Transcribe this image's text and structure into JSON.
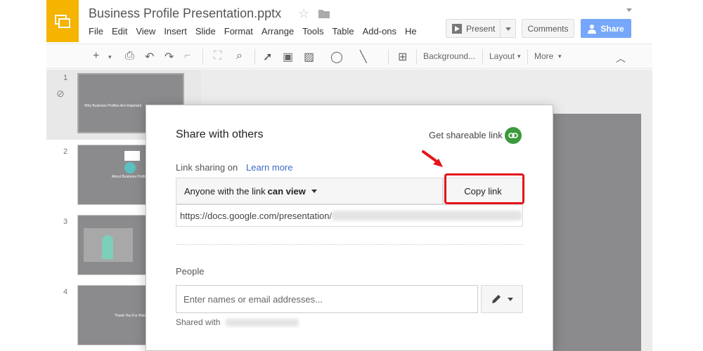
{
  "app": {
    "doc_title": "Business Profile Presentation.pptx",
    "menu": [
      "File",
      "Edit",
      "View",
      "Insert",
      "Slide",
      "Format",
      "Arrange",
      "Tools",
      "Table",
      "Add-ons",
      "He"
    ],
    "present_label": "Present",
    "comments_label": "Comments",
    "share_label": "Share",
    "accent_color": "#76a7fa",
    "logo_color": "#f4b400"
  },
  "toolbar": {
    "background_label": "Background...",
    "layout_label": "Layout",
    "more_label": "More"
  },
  "filmstrip": {
    "slides": [
      {
        "number": "1",
        "title": "Why Business Profiles Are Important"
      },
      {
        "number": "2",
        "title": "About Business Profile"
      },
      {
        "number": "3",
        "title": ""
      },
      {
        "number": "4",
        "title": "Thank You For Watching"
      }
    ]
  },
  "dialog": {
    "title": "Share with others",
    "get_shareable_link": "Get shareable link",
    "link_sharing_label": "Link sharing on",
    "learn_more": "Learn more",
    "access_prefix": "Anyone with the link ",
    "access_level": "can view",
    "copy_link": "Copy link",
    "url": "https://docs.google.com/presentation/",
    "people_label": "People",
    "people_placeholder": "Enter names or email addresses...",
    "shared_with_label": "Shared with",
    "highlight_color": "#e4141b"
  }
}
